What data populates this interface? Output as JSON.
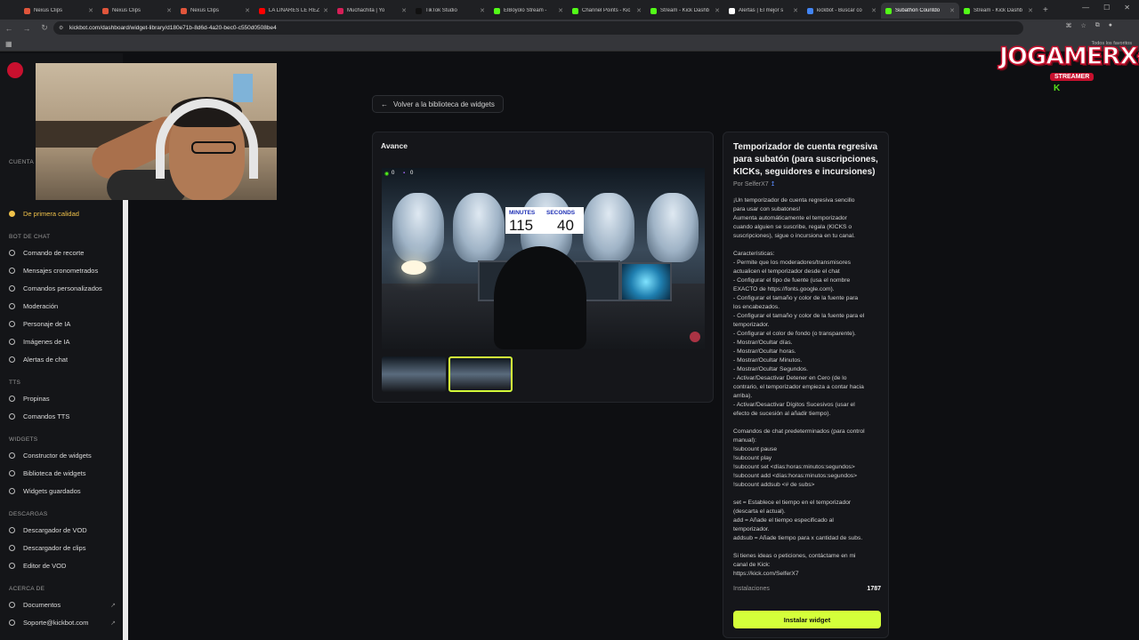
{
  "browser": {
    "tabs": [
      {
        "title": "Nexus Clips",
        "color": "#e0553b"
      },
      {
        "title": "Nexus Clips",
        "color": "#e0553b"
      },
      {
        "title": "Nexus Clips",
        "color": "#e0553b"
      },
      {
        "title": "LA LINARES LE REZ",
        "color": "#ff0000"
      },
      {
        "title": "Muchachita | Yo",
        "color": "#d61f57"
      },
      {
        "title": "TikTok Studio",
        "color": "#111111"
      },
      {
        "title": "ElBoyolo Stream -",
        "color": "#53fc18"
      },
      {
        "title": "Channel Points - Kic",
        "color": "#53fc18"
      },
      {
        "title": "Stream - Kick Dashb",
        "color": "#53fc18"
      },
      {
        "title": "Alertas | El mejor s",
        "color": "#ffffff"
      },
      {
        "title": "kickbot - Buscar co",
        "color": "#4285f4"
      },
      {
        "title": "Subathon Countdo",
        "color": "#53fc18"
      },
      {
        "title": "Stream - Kick Dashb",
        "color": "#53fc18"
      }
    ],
    "url": "kickbot.com/dashboard/widget-library/d180e71b-8d6d-4a20-bec0-c550d0508be4",
    "bookmarks_label": "Todos los favoritos"
  },
  "sidebar": {
    "sections": [
      {
        "label": "Cuenta"
      },
      {
        "label": "Bot de chat"
      },
      {
        "label": "TTS"
      },
      {
        "label": "Widgets"
      },
      {
        "label": "Descargas"
      },
      {
        "label": "Acerca de"
      }
    ],
    "premium_item": "De primera calidad",
    "chatbot_items": [
      "Comando de recorte",
      "Mensajes cronometrados",
      "Comandos personalizados",
      "Moderación",
      "Personaje de IA",
      "Imágenes de IA",
      "Alertas de chat"
    ],
    "tts_items": [
      "Propinas",
      "Comandos TTS"
    ],
    "widget_items": [
      "Constructor de widgets",
      "Biblioteca de widgets",
      "Widgets guardados"
    ],
    "download_items": [
      "Descargador de VOD",
      "Descargador de clips",
      "Editor de VOD"
    ],
    "about_items": [
      "Documentos",
      "Soporte@kickbot.com"
    ]
  },
  "overlay": {
    "logo_text": "JOGAMERX",
    "logo_suffix": "t",
    "logo_badge": "STREAMER",
    "logo_k": "K"
  },
  "main": {
    "back_label": "Volver a la biblioteca de widgets",
    "preview_title": "Avance",
    "preview": {
      "viewers": "0",
      "chat": "0",
      "minutes_label": "MINUTES",
      "seconds_label": "SECONDS",
      "minutes_value": "115",
      "seconds_value": "40"
    }
  },
  "widget": {
    "title": "Temporizador de cuenta regresiva para subatón (para suscripciones, KICKs, seguidores e incursiones)",
    "author": "Por SelferX7",
    "description": [
      "¡Un temporizador de cuenta regresiva sencillo",
      "para usar con subatones!",
      "Aumenta automáticamente el temporizador",
      "cuando alguien se suscribe, regala (KICKS o",
      "suscripciones), sigue o incursiona en tu canal.",
      "",
      "Características:",
      "- Permite que los moderadores/transmisores",
      "actualicen el temporizador desde el chat",
      "- Configurar el tipo de fuente (usa el nombre",
      "EXACTO de https://fonts.google.com).",
      "- Configurar el tamaño y color de la fuente para",
      "los encabezados.",
      "- Configurar el tamaño y color de la fuente para el",
      "temporizador.",
      "- Configurar el color de fondo (o transparente).",
      "- Mostrar/Ocultar días.",
      "- Mostrar/Ocultar horas.",
      "- Mostrar/Ocultar Minutos.",
      "- Mostrar/Ocultar Segundos.",
      "- Activar/Desactivar Detener en Cero (de lo",
      "contrario, el temporizador empieza a contar hacia",
      "arriba).",
      "- Activar/Desactivar Dígitos Sucesivos (usar el",
      "efecto de sucesión al añadir tiempo).",
      "",
      "Comandos de chat predeterminados (para control",
      "manual):",
      "!subcount pause",
      "!subcount play",
      "!subcount set <días:horas:minutos:segundos>",
      "!subcount add <días:horas:minutos:segundos>",
      "!subcount addsub <# de subs>",
      "",
      "set = Establece el tiempo en el temporizador",
      "(descarta el actual).",
      "add = Añade el tiempo especificado al",
      "temporizador.",
      "addsub = Añade tiempo para x cantidad de subs.",
      "",
      "Si tienes ideas o peticiones, contáctame en mi",
      "canal de Kick:",
      "https://kick.com/SelferX7"
    ],
    "installs_label": "Instalaciones",
    "installs_value": "1787",
    "install_button": "Instalar widget"
  },
  "colors": {
    "accent": "#d4ff3a",
    "premium": "#f0c24a",
    "timer_label": "#1d2fb5"
  }
}
